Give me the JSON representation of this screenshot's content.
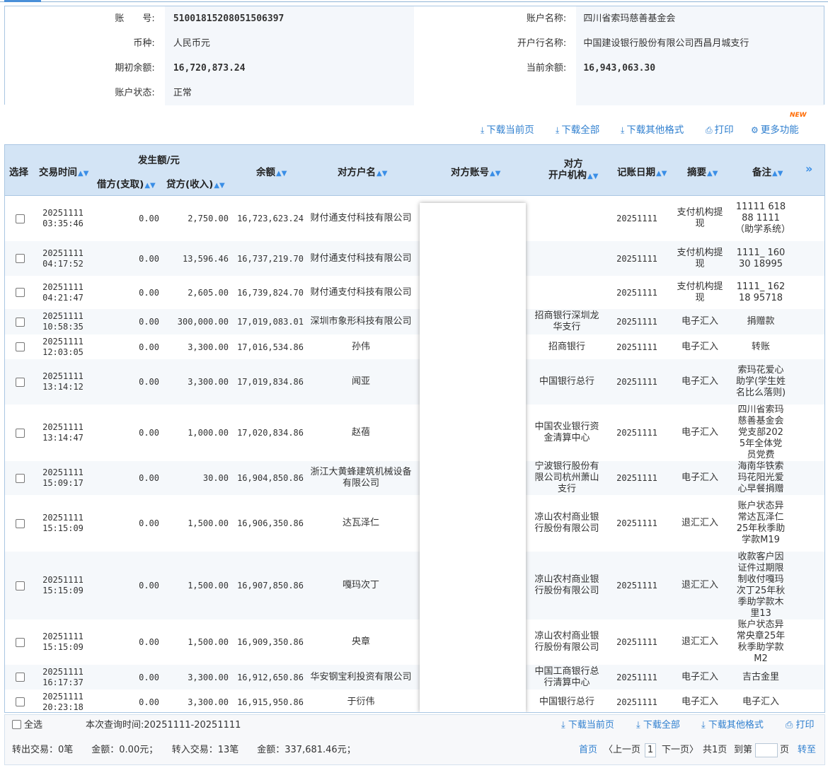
{
  "account": {
    "acct_no_label": "账　　号:",
    "acct_no": "51001815208051506397",
    "acct_name_label": "账户名称:",
    "acct_name": "四川省索玛慈善基金会",
    "currency_label": "币种:",
    "currency": "人民币元",
    "bank_label": "开户行名称:",
    "bank": "中国建设银行股份有限公司西昌月城支行",
    "opening_label": "期初余额:",
    "opening": "16,720,873.24",
    "current_label": "当前余额:",
    "current": "16,943,063.30",
    "status_label": "账户状态:",
    "status": "正常"
  },
  "toolbar": {
    "download_page": "下载当前页",
    "download_all": "下载全部",
    "download_other": "下载其他格式",
    "print": "打印",
    "more": "更多功能",
    "new_badge": "NEW"
  },
  "columns": {
    "select": "选择",
    "time": "交易时间",
    "amount_group": "发生额/元",
    "debit": "借方(支取)",
    "credit": "贷方(收入)",
    "balance": "余额",
    "counter_name": "对方户名",
    "counter_acct": "对方账号",
    "counter_bank_1": "对方",
    "counter_bank_2": "开户机构",
    "post_date": "记账日期",
    "summary": "摘要",
    "remark": "备注"
  },
  "rows": [
    {
      "date": "20251111",
      "time": "03:35:46",
      "debit": "0.00",
      "credit": "2,750.00",
      "balance": "16,723,623.24",
      "name": "财付通支付科技有限公司",
      "bank": "",
      "post": "20251111",
      "summary": "支付机构提现",
      "remark": "11111 61888 1111（助学系统）"
    },
    {
      "date": "20251111",
      "time": "04:17:52",
      "debit": "0.00",
      "credit": "13,596.46",
      "balance": "16,737,219.70",
      "name": "财付通支付科技有限公司",
      "bank": "",
      "post": "20251111",
      "summary": "支付机构提现",
      "remark": "1111_ 16030 18995"
    },
    {
      "date": "20251111",
      "time": "04:21:47",
      "debit": "0.00",
      "credit": "2,605.00",
      "balance": "16,739,824.70",
      "name": "财付通支付科技有限公司",
      "bank": "",
      "post": "20251111",
      "summary": "支付机构提现",
      "remark": "1111_ 16218 95718"
    },
    {
      "date": "20251111",
      "time": "10:58:35",
      "debit": "0.00",
      "credit": "300,000.00",
      "balance": "17,019,083.01",
      "name": "深圳市象形科技有限公司",
      "bank": "招商银行深圳龙华支行",
      "post": "20251111",
      "summary": "电子汇入",
      "remark": "捐赠款"
    },
    {
      "date": "20251111",
      "time": "12:03:05",
      "debit": "0.00",
      "credit": "3,300.00",
      "balance": "17,016,534.86",
      "name": "孙伟",
      "bank": "招商银行",
      "post": "20251111",
      "summary": "电子汇入",
      "remark": "转账"
    },
    {
      "date": "20251111",
      "time": "13:14:12",
      "debit": "0.00",
      "credit": "3,300.00",
      "balance": "17,019,834.86",
      "name": "闻亚",
      "bank": "中国银行总行",
      "post": "20251111",
      "summary": "电子汇入",
      "remark": "索玛花爱心助学(学生姓名比么落则)"
    },
    {
      "date": "20251111",
      "time": "13:14:47",
      "debit": "0.00",
      "credit": "1,000.00",
      "balance": "17,020,834.86",
      "name": "赵蓓",
      "bank": "中国农业银行资金清算中心",
      "post": "20251111",
      "summary": "电子汇入",
      "remark": "四川省索玛慈善基金会党支部2025年全体党员党费"
    },
    {
      "date": "20251111",
      "time": "15:09:17",
      "debit": "0.00",
      "credit": "30.00",
      "balance": "16,904,850.86",
      "name": "浙江大黄蜂建筑机械设备有限公司",
      "bank": "宁波银行股份有限公司杭州萧山支行",
      "post": "20251111",
      "summary": "电子汇入",
      "remark": "海南华铁索玛花阳光爱心早餐捐赠"
    },
    {
      "date": "20251111",
      "time": "15:15:09",
      "debit": "0.00",
      "credit": "1,500.00",
      "balance": "16,906,350.86",
      "name": "达瓦泽仁",
      "bank": "凉山农村商业银行股份有限公司",
      "post": "20251111",
      "summary": "退汇汇入",
      "remark": "账户状态异常达瓦泽仁25年秋季助学款M19"
    },
    {
      "date": "20251111",
      "time": "15:15:09",
      "debit": "0.00",
      "credit": "1,500.00",
      "balance": "16,907,850.86",
      "name": "嘎玛次丁",
      "bank": "凉山农村商业银行股份有限公司",
      "post": "20251111",
      "summary": "退汇汇入",
      "remark": "收款客户因证件过期限制收付嘎玛次丁25年秋季助学款木里13"
    },
    {
      "date": "20251111",
      "time": "15:15:09",
      "debit": "0.00",
      "credit": "1,500.00",
      "balance": "16,909,350.86",
      "name": "央章",
      "bank": "凉山农村商业银行股份有限公司",
      "post": "20251111",
      "summary": "退汇汇入",
      "remark": "账户状态异常央章25年秋季助学款M2"
    },
    {
      "date": "20251111",
      "time": "16:17:37",
      "debit": "0.00",
      "credit": "3,300.00",
      "balance": "16,912,650.86",
      "name": "华安钢宝利投资有限公司",
      "bank": "中国工商银行总行清算中心",
      "post": "20251111",
      "summary": "电子汇入",
      "remark": "吉古金里"
    },
    {
      "date": "20251111",
      "time": "20:23:18",
      "debit": "0.00",
      "credit": "3,300.00",
      "balance": "16,915,950.86",
      "name": "于衍伟",
      "bank": "中国银行总行",
      "post": "20251111",
      "summary": "电子汇入",
      "remark": "电子汇入"
    }
  ],
  "footer": {
    "select_all": "全选",
    "query_time": "本次查询时间:20251111-20251111",
    "download_page": "下载当前页",
    "download_all": "下载全部",
    "download_other": "下载其他格式",
    "print": "打印",
    "summary": "转出交易：0笔　　金额：0.00元；　　转入交易：13笔　　金额：337,681.46元；",
    "first": "首页",
    "prev": "〈上一页",
    "page": "1",
    "next": "下一页〉",
    "total": "共1页",
    "goto": "到第",
    "page_unit": "页",
    "jump": "转至"
  }
}
